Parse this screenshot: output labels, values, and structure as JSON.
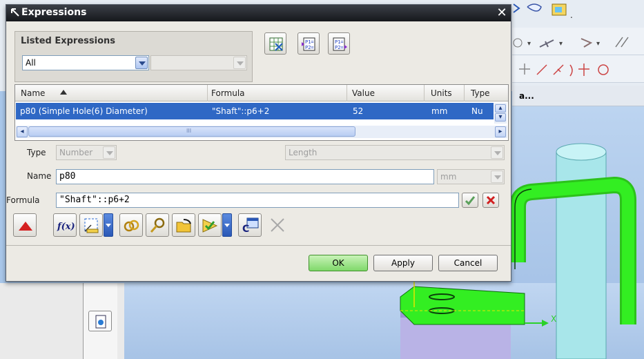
{
  "dialog": {
    "title": "Expressions",
    "close_glyph": "✕"
  },
  "listed": {
    "title": "Listed Expressions",
    "filter_value": "All",
    "second_value": ""
  },
  "table": {
    "columns": [
      "Name",
      "Formula",
      "Value",
      "Units",
      "Type"
    ],
    "rows": [
      {
        "name": "p80  (Simple Hole(6) Diameter)",
        "formula": "\"Shaft\"::p6+2",
        "value": "52",
        "units": "mm",
        "type": "Nu"
      }
    ],
    "scroll_mark": "III"
  },
  "editor": {
    "type_label": "Type",
    "type_value": "Number",
    "dimension_value": "Length",
    "name_label": "Name",
    "name_value": "p80",
    "units_value": "mm",
    "formula_label": "Formula",
    "formula_value": "\"Shaft\"::p6+2"
  },
  "toolbar": {
    "fx_label": "f(x)"
  },
  "buttons": {
    "ok": "OK",
    "apply": "Apply",
    "cancel": "Cancel"
  },
  "background": {
    "tab_label": "a..."
  },
  "icons": [
    "spreadsheet-icon",
    "import-expressions-icon",
    "export-expressions-icon",
    "collapse-icon",
    "function-icon",
    "measure-icon",
    "reference-icon",
    "query-icon",
    "open-folder-icon",
    "check-link-icon",
    "dialog-icon",
    "delete-icon",
    "accept-icon",
    "reject-icon"
  ],
  "colors": {
    "selection": "#2f68c5",
    "ok_green": "#7fd86a",
    "part_green": "#33ee22",
    "shaft_cyan": "#a8e6ea"
  }
}
